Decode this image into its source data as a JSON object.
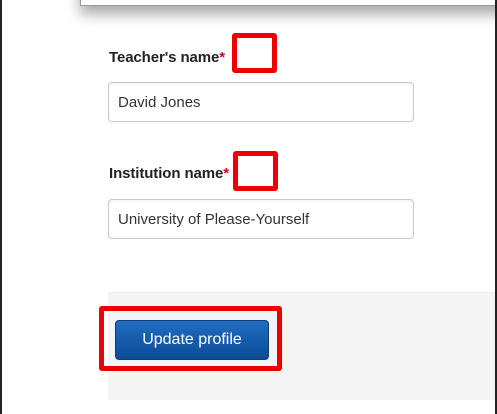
{
  "form": {
    "teacher_name": {
      "label": "Teacher's name",
      "required_marker": "*",
      "value": "David Jones"
    },
    "institution_name": {
      "label": "Institution name",
      "required_marker": "*",
      "value": "University of Please-Yourself"
    },
    "update_button_label": "Update profile"
  },
  "colors": {
    "highlight": "#ee0000",
    "required": "#d0021b",
    "button": "#0b4c94"
  }
}
